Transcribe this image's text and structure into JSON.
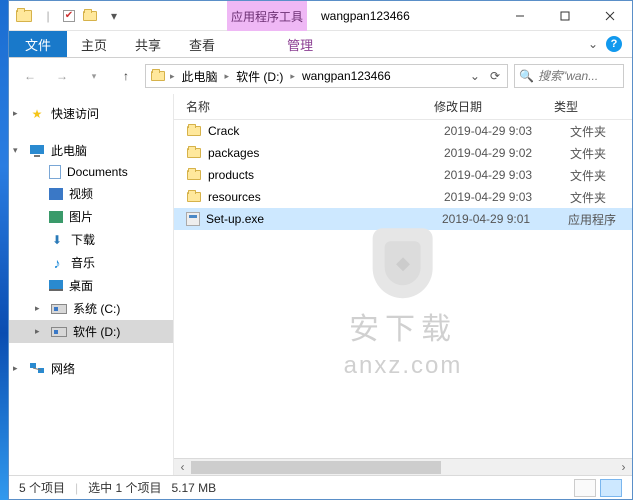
{
  "window": {
    "context_tab": "应用程序工具",
    "title": "wangpan123466"
  },
  "tabs": {
    "file": "文件",
    "home": "主页",
    "share": "共享",
    "view": "查看",
    "manage": "管理"
  },
  "breadcrumb": {
    "root": "此电脑",
    "drive": "软件 (D:)",
    "folder": "wangpan123466"
  },
  "search": {
    "placeholder": "搜索\"wan..."
  },
  "nav": {
    "quick": "快速访问",
    "pc": "此电脑",
    "documents": "Documents",
    "video": "视频",
    "pictures": "图片",
    "downloads": "下载",
    "music": "音乐",
    "desktop": "桌面",
    "sysdrive": "系统 (C:)",
    "swdrive": "软件 (D:)",
    "network": "网络"
  },
  "columns": {
    "name": "名称",
    "date": "修改日期",
    "type": "类型"
  },
  "files": [
    {
      "name": "Crack",
      "date": "2019-04-29 9:03",
      "type": "文件夹",
      "kind": "folder"
    },
    {
      "name": "packages",
      "date": "2019-04-29 9:02",
      "type": "文件夹",
      "kind": "folder"
    },
    {
      "name": "products",
      "date": "2019-04-29 9:03",
      "type": "文件夹",
      "kind": "folder"
    },
    {
      "name": "resources",
      "date": "2019-04-29 9:03",
      "type": "文件夹",
      "kind": "folder"
    },
    {
      "name": "Set-up.exe",
      "date": "2019-04-29 9:01",
      "type": "应用程序",
      "kind": "exe",
      "selected": true
    }
  ],
  "status": {
    "count": "5 个项目",
    "selection": "选中 1 个项目",
    "size": "5.17 MB"
  },
  "watermark": {
    "line1": "安下载",
    "line2": "anxz.com"
  }
}
